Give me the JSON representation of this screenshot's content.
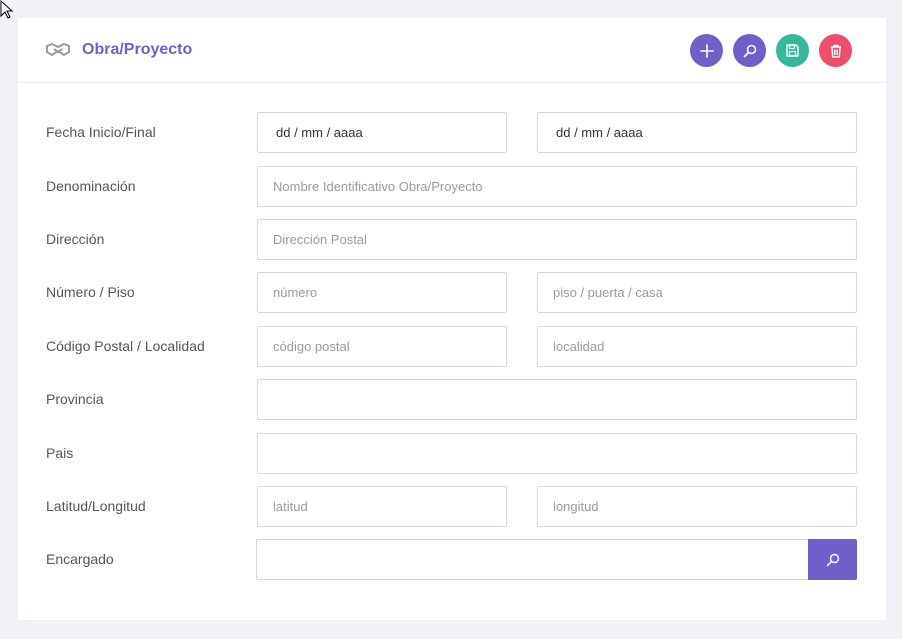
{
  "header": {
    "title": "Obra/Proyecto",
    "icon": "handshake-icon",
    "actions": [
      {
        "name": "add-button",
        "icon": "plus-icon",
        "color": "#6f5fc9"
      },
      {
        "name": "search-button",
        "icon": "search-icon",
        "color": "#6f5fc9"
      },
      {
        "name": "save-button",
        "icon": "save-icon",
        "color": "#35b99a"
      },
      {
        "name": "delete-button",
        "icon": "trash-icon",
        "color": "#ec4e6c"
      }
    ]
  },
  "form": {
    "fecha": {
      "label": "Fecha Inicio/Final",
      "inicio_value": "dd / mm / aaaa",
      "final_value": "dd / mm / aaaa"
    },
    "denominacion": {
      "label": "Denominación",
      "placeholder": "Nombre Identificativo Obra/Proyecto"
    },
    "direccion": {
      "label": "Dirección",
      "placeholder": "Dirección Postal"
    },
    "numero_piso": {
      "label": "Número / Piso",
      "numero_placeholder": "número",
      "piso_placeholder": "piso / puerta / casa"
    },
    "cp_localidad": {
      "label": "Código Postal / Localidad",
      "cp_placeholder": "código postal",
      "localidad_placeholder": "localidad"
    },
    "provincia": {
      "label": "Provincia",
      "value": ""
    },
    "pais": {
      "label": "Pais",
      "value": ""
    },
    "lat_long": {
      "label": "Latitud/Longitud",
      "latitud_placeholder": "latitud",
      "longitud_placeholder": "longitud"
    },
    "encargado": {
      "label": "Encargado",
      "value": "",
      "search_icon": "search-icon"
    }
  },
  "colors": {
    "accent": "#6f5fc9",
    "success": "#35b99a",
    "danger": "#ec4e6c",
    "background": "#f1f1f8"
  }
}
